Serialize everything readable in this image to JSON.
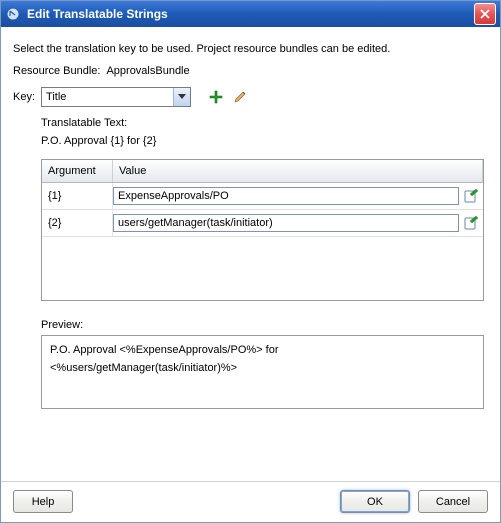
{
  "window": {
    "title": "Edit Translatable Strings"
  },
  "info": "Select the translation key to be used. Project resource bundles can be edited.",
  "resourceBundle": {
    "label": "Resource Bundle:",
    "value": "ApprovalsBundle"
  },
  "keyRow": {
    "label": "Key:",
    "selected": "Title"
  },
  "translatable": {
    "label": "Translatable Text:",
    "text": "P.O. Approval {1} for {2}"
  },
  "table": {
    "headers": {
      "argument": "Argument",
      "value": "Value"
    },
    "rows": [
      {
        "arg": "{1}",
        "val": "ExpenseApprovals/PO"
      },
      {
        "arg": "{2}",
        "val": "users/getManager(task/initiator)"
      }
    ]
  },
  "preview": {
    "label": "Preview:",
    "line1": "P.O. Approval <%ExpenseApprovals/PO%> for",
    "line2": "<%users/getManager(task/initiator)%>"
  },
  "buttons": {
    "help": "Help",
    "ok": "OK",
    "cancel": "Cancel"
  }
}
